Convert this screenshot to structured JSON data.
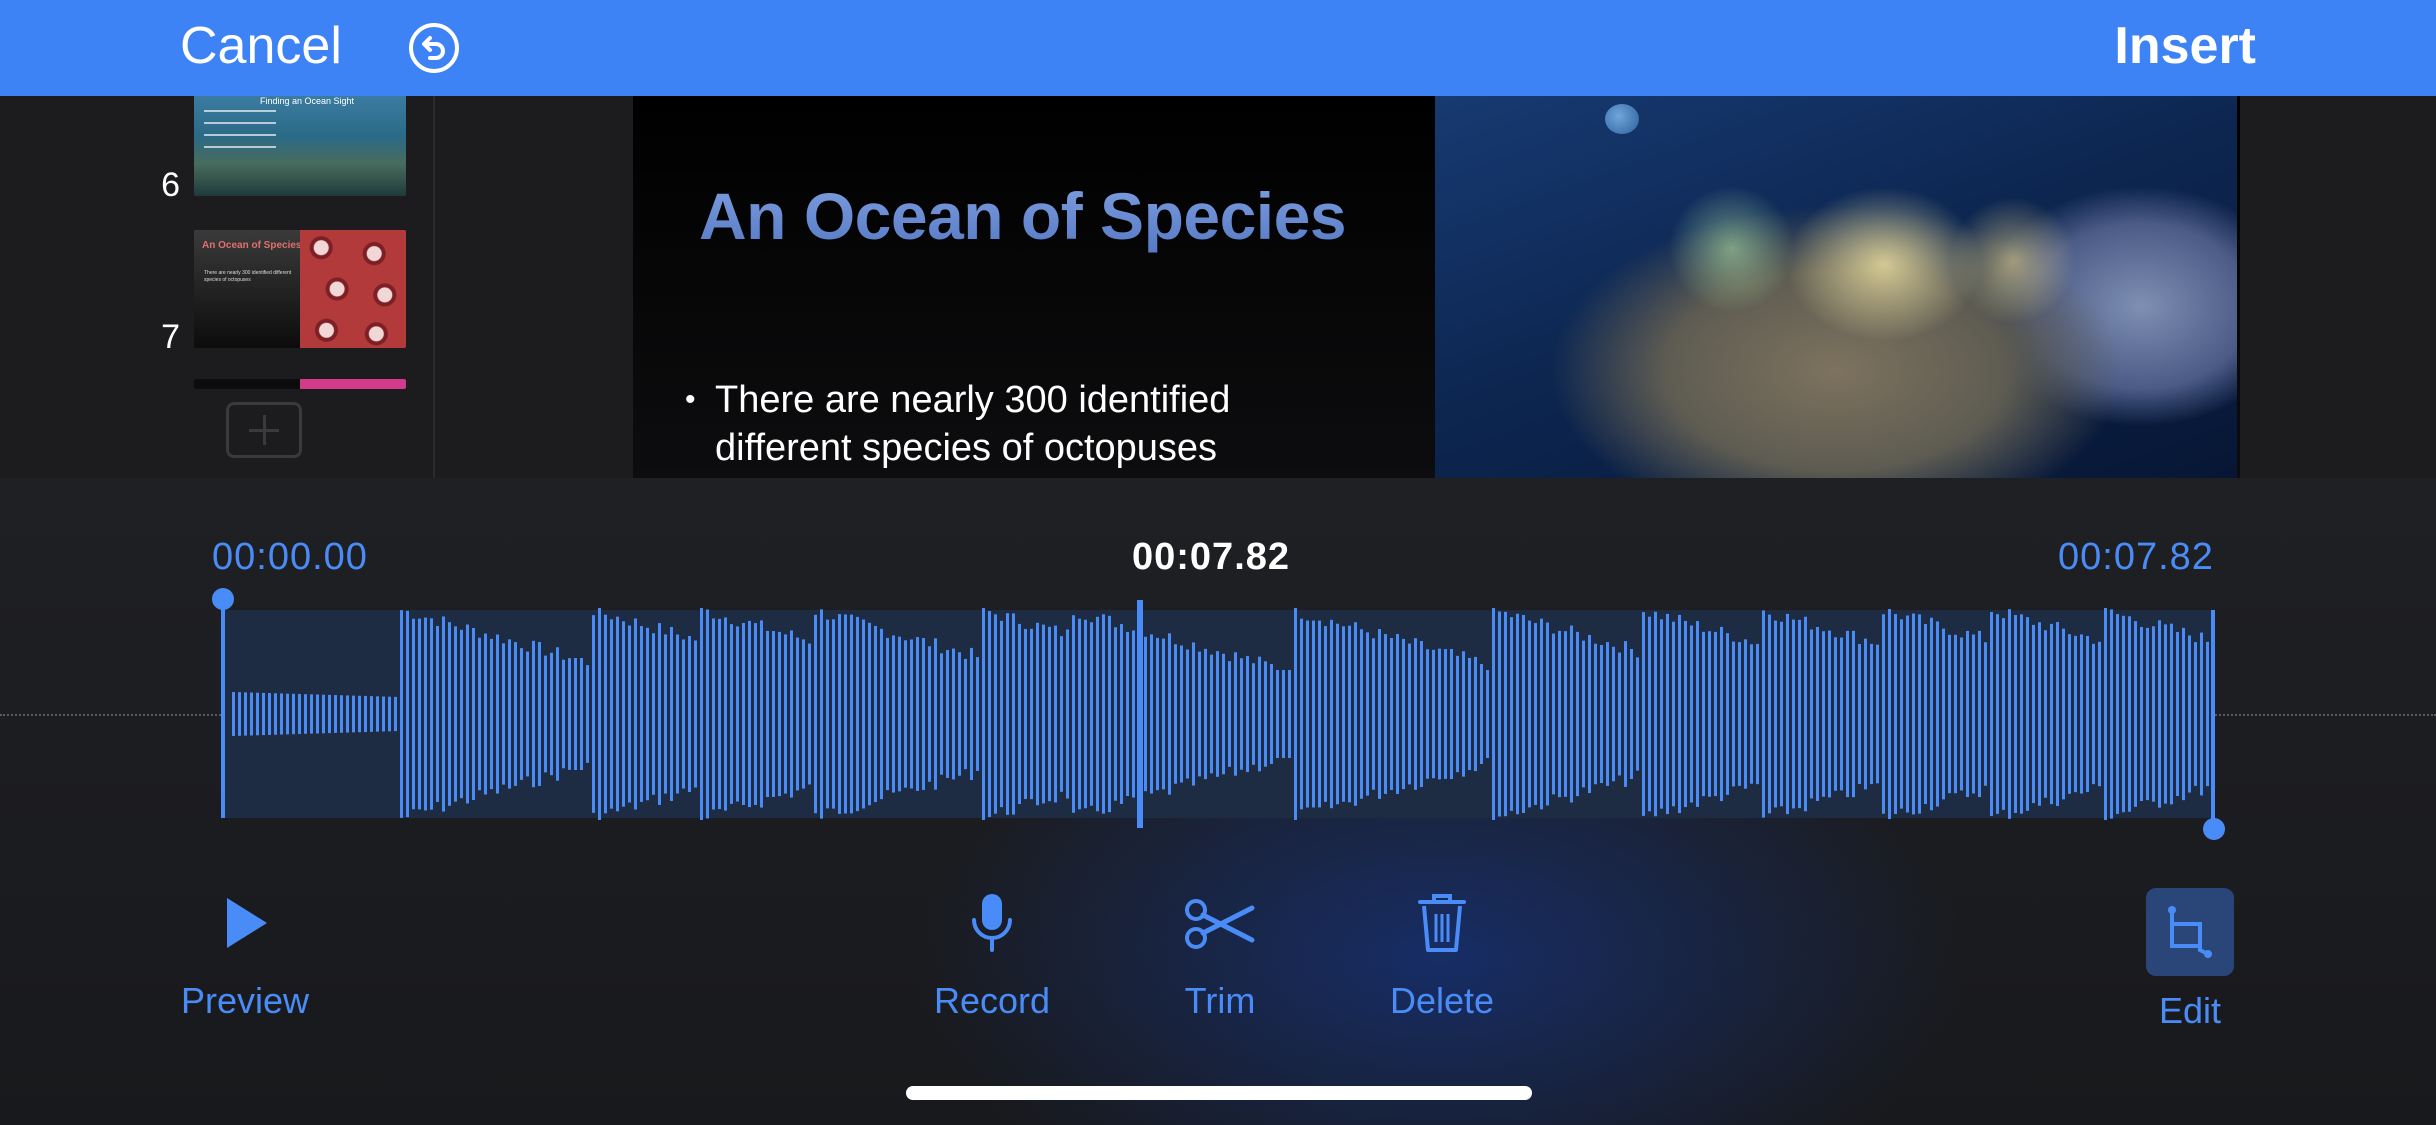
{
  "topbar": {
    "cancel_label": "Cancel",
    "insert_label": "Insert",
    "undo_icon": "undo-icon",
    "bg_color": "#3e83f6"
  },
  "navigator": {
    "slides": [
      {
        "number": "6",
        "title": "Finding an Ocean Sight"
      },
      {
        "number": "7",
        "title": "An Ocean of Species",
        "text": "There are nearly 300 identified different species of octopuses"
      }
    ]
  },
  "slide": {
    "title": "An Ocean of Species",
    "bullet": "There are nearly 300 identified different species of octopuses"
  },
  "audio": {
    "start_time": "00:00.00",
    "current_time": "00:07.82",
    "end_time": "00:07.82",
    "accent_color": "#4a8cf7"
  },
  "toolbar": {
    "preview_label": "Preview",
    "record_label": "Record",
    "trim_label": "Trim",
    "delete_label": "Delete",
    "edit_label": "Edit"
  }
}
